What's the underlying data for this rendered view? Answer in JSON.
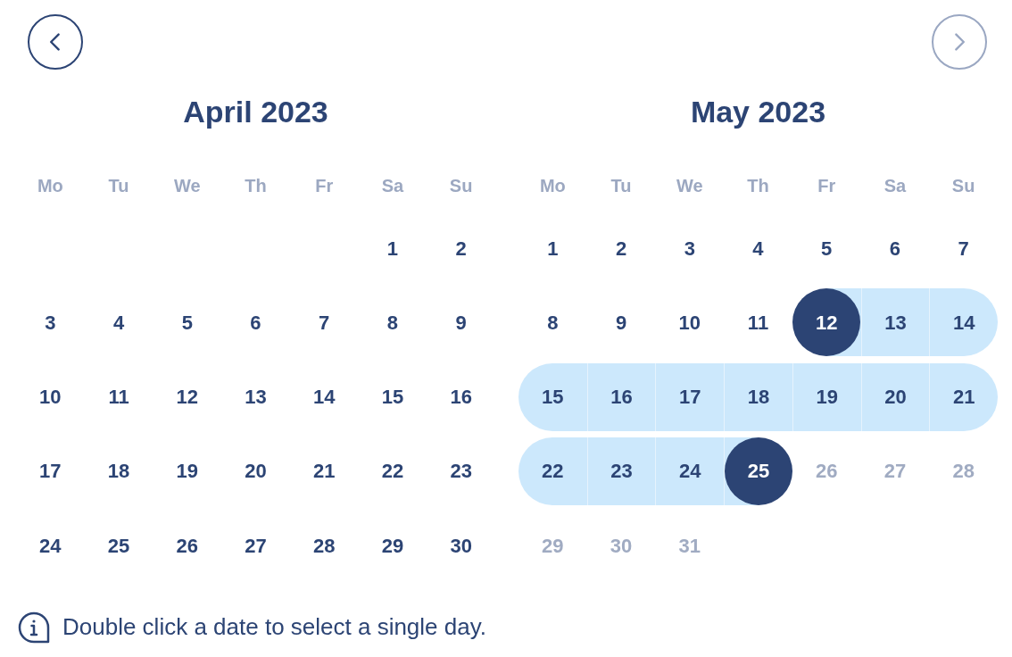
{
  "navigation": {
    "previous": {
      "disabled": false
    },
    "next": {
      "disabled": true
    }
  },
  "months": [
    {
      "title": "April 2023",
      "weekdays": [
        "Mo",
        "Tu",
        "We",
        "Th",
        "Fr",
        "Sa",
        "Su"
      ],
      "weeks": [
        [
          {
            "day": "1",
            "selected": false,
            "in_range": false,
            "disabled": false
          },
          {
            "day": "2",
            "selected": false,
            "in_range": false,
            "disabled": false
          }
        ],
        [
          {
            "day": "3",
            "selected": false,
            "in_range": false,
            "disabled": false
          },
          {
            "day": "4",
            "selected": false,
            "in_range": false,
            "disabled": false
          },
          {
            "day": "5",
            "selected": false,
            "in_range": false,
            "disabled": false
          },
          {
            "day": "6",
            "selected": false,
            "in_range": false,
            "disabled": false
          },
          {
            "day": "7",
            "selected": false,
            "in_range": false,
            "disabled": false
          },
          {
            "day": "8",
            "selected": false,
            "in_range": false,
            "disabled": false
          },
          {
            "day": "9",
            "selected": false,
            "in_range": false,
            "disabled": false
          }
        ],
        [
          {
            "day": "10",
            "selected": false,
            "in_range": false,
            "disabled": false
          },
          {
            "day": "11",
            "selected": false,
            "in_range": false,
            "disabled": false
          },
          {
            "day": "12",
            "selected": false,
            "in_range": false,
            "disabled": false
          },
          {
            "day": "13",
            "selected": false,
            "in_range": false,
            "disabled": false
          },
          {
            "day": "14",
            "selected": false,
            "in_range": false,
            "disabled": false
          },
          {
            "day": "15",
            "selected": false,
            "in_range": false,
            "disabled": false
          },
          {
            "day": "16",
            "selected": false,
            "in_range": false,
            "disabled": false
          }
        ],
        [
          {
            "day": "17",
            "selected": false,
            "in_range": false,
            "disabled": false
          },
          {
            "day": "18",
            "selected": false,
            "in_range": false,
            "disabled": false
          },
          {
            "day": "19",
            "selected": false,
            "in_range": false,
            "disabled": false
          },
          {
            "day": "20",
            "selected": false,
            "in_range": false,
            "disabled": false
          },
          {
            "day": "21",
            "selected": false,
            "in_range": false,
            "disabled": false
          },
          {
            "day": "22",
            "selected": false,
            "in_range": false,
            "disabled": false
          },
          {
            "day": "23",
            "selected": false,
            "in_range": false,
            "disabled": false
          }
        ],
        [
          {
            "day": "24",
            "selected": false,
            "in_range": false,
            "disabled": false
          },
          {
            "day": "25",
            "selected": false,
            "in_range": false,
            "disabled": false
          },
          {
            "day": "26",
            "selected": false,
            "in_range": false,
            "disabled": false
          },
          {
            "day": "27",
            "selected": false,
            "in_range": false,
            "disabled": false
          },
          {
            "day": "28",
            "selected": false,
            "in_range": false,
            "disabled": false
          },
          {
            "day": "29",
            "selected": false,
            "in_range": false,
            "disabled": false
          },
          {
            "day": "30",
            "selected": false,
            "in_range": false,
            "disabled": false
          }
        ]
      ]
    },
    {
      "title": "May 2023",
      "weekdays": [
        "Mo",
        "Tu",
        "We",
        "Th",
        "Fr",
        "Sa",
        "Su"
      ],
      "weeks": [
        [
          {
            "day": "1",
            "selected": false,
            "in_range": false,
            "disabled": false
          },
          {
            "day": "2",
            "selected": false,
            "in_range": false,
            "disabled": false
          },
          {
            "day": "3",
            "selected": false,
            "in_range": false,
            "disabled": false
          },
          {
            "day": "4",
            "selected": false,
            "in_range": false,
            "disabled": false
          },
          {
            "day": "5",
            "selected": false,
            "in_range": false,
            "disabled": false
          },
          {
            "day": "6",
            "selected": false,
            "in_range": false,
            "disabled": false
          },
          {
            "day": "7",
            "selected": false,
            "in_range": false,
            "disabled": false
          }
        ],
        [
          {
            "day": "8",
            "selected": false,
            "in_range": false,
            "disabled": false
          },
          {
            "day": "9",
            "selected": false,
            "in_range": false,
            "disabled": false
          },
          {
            "day": "10",
            "selected": false,
            "in_range": false,
            "disabled": false
          },
          {
            "day": "11",
            "selected": false,
            "in_range": false,
            "disabled": false
          },
          {
            "day": "12",
            "selected": true,
            "in_range": false,
            "disabled": false
          },
          {
            "day": "13",
            "selected": false,
            "in_range": true,
            "disabled": false
          },
          {
            "day": "14",
            "selected": false,
            "in_range": true,
            "disabled": false
          }
        ],
        [
          {
            "day": "15",
            "selected": false,
            "in_range": true,
            "disabled": false
          },
          {
            "day": "16",
            "selected": false,
            "in_range": true,
            "disabled": false
          },
          {
            "day": "17",
            "selected": false,
            "in_range": true,
            "disabled": false
          },
          {
            "day": "18",
            "selected": false,
            "in_range": true,
            "disabled": false
          },
          {
            "day": "19",
            "selected": false,
            "in_range": true,
            "disabled": false
          },
          {
            "day": "20",
            "selected": false,
            "in_range": true,
            "disabled": false
          },
          {
            "day": "21",
            "selected": false,
            "in_range": true,
            "disabled": false
          }
        ],
        [
          {
            "day": "22",
            "selected": false,
            "in_range": true,
            "disabled": false
          },
          {
            "day": "23",
            "selected": false,
            "in_range": true,
            "disabled": false
          },
          {
            "day": "24",
            "selected": false,
            "in_range": true,
            "disabled": false
          },
          {
            "day": "25",
            "selected": true,
            "in_range": false,
            "disabled": false
          },
          {
            "day": "26",
            "selected": false,
            "in_range": false,
            "disabled": true
          },
          {
            "day": "27",
            "selected": false,
            "in_range": false,
            "disabled": true
          },
          {
            "day": "28",
            "selected": false,
            "in_range": false,
            "disabled": true
          }
        ],
        [
          {
            "day": "29",
            "selected": false,
            "in_range": false,
            "disabled": true
          },
          {
            "day": "30",
            "selected": false,
            "in_range": false,
            "disabled": true
          },
          {
            "day": "31",
            "selected": false,
            "in_range": false,
            "disabled": true
          }
        ]
      ]
    }
  ],
  "hint": "Double click a date to select a single day."
}
